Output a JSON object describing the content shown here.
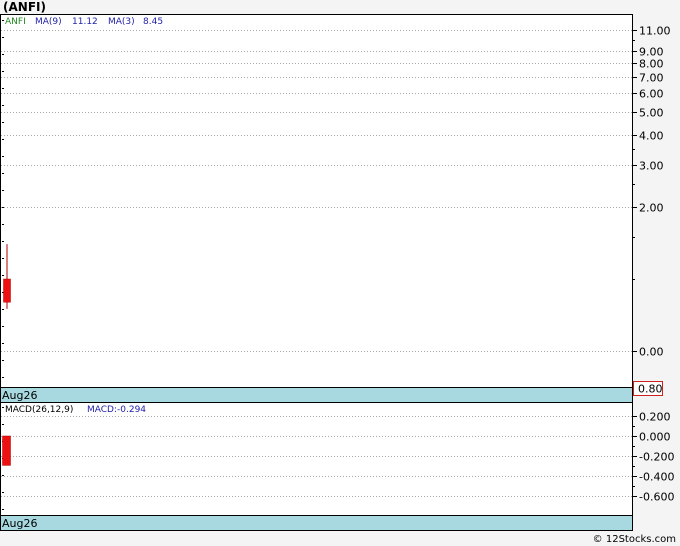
{
  "title": "(ANFI)",
  "footer": "© 12Stocks.com",
  "legend": {
    "ticker": "ANFI",
    "ma9_label": "MA(9)",
    "ma9_value": "11.12",
    "ma3_label": "MA(3)",
    "ma3_value": "8.45"
  },
  "macd_legend": {
    "label": "MACD(26,12,9)",
    "value": "MACD:-0.294"
  },
  "current_price": "0.80",
  "colors": {
    "candle": "#ee1111",
    "wick": "#aa0000",
    "date_band": "#a8d8e0",
    "price_box_border": "#cc2222",
    "legend_ticker": "#228822",
    "legend_ma": "#2222aa",
    "grid": "#a8a8a8"
  },
  "chart_data": [
    {
      "type": "candlestick",
      "panel": "price",
      "scale": "log",
      "y_tick_labels": [
        "11.00",
        "9.00",
        "8.00",
        "7.00",
        "6.00",
        "5.00",
        "4.00",
        "3.00",
        "2.00",
        "0.00"
      ],
      "x_tick_labels": [
        "Aug26"
      ],
      "candles": [
        {
          "date": "Aug26",
          "open": 1.0,
          "high": 1.4,
          "low": 0.75,
          "close": 0.8
        }
      ],
      "grid": true
    },
    {
      "type": "bar",
      "panel": "macd",
      "y_tick_labels": [
        "0.200",
        "0.000",
        "-0.200",
        "-0.400",
        "-0.600"
      ],
      "ylim": [
        -0.72,
        0.3
      ],
      "x_tick_labels": [
        "Aug26"
      ],
      "bars": [
        {
          "date": "Aug26",
          "top": 0.0,
          "bottom": -0.294
        }
      ],
      "grid": true
    }
  ]
}
